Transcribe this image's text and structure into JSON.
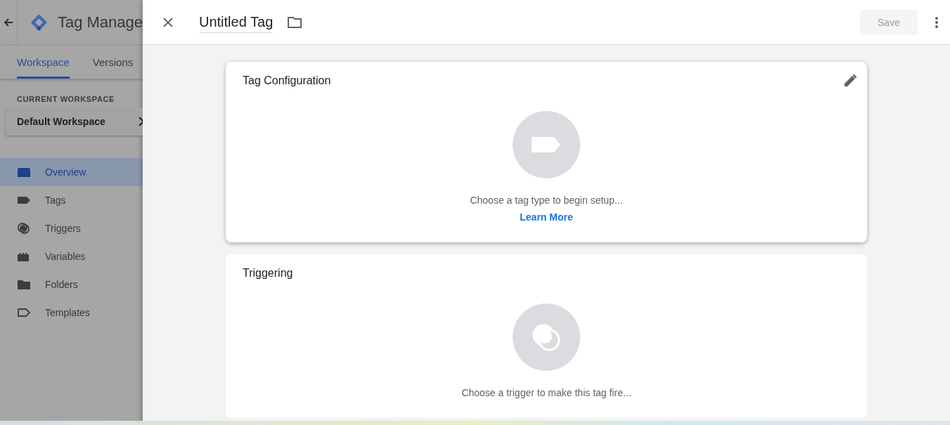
{
  "app": {
    "title": "Tag Manage"
  },
  "tabs": [
    {
      "label": "Workspace",
      "selected": true
    },
    {
      "label": "Versions",
      "selected": false
    }
  ],
  "workspace": {
    "heading": "CURRENT WORKSPACE",
    "name": "Default Workspace"
  },
  "nav": [
    {
      "label": "Overview",
      "kind": "overview",
      "selected": true
    },
    {
      "label": "Tags",
      "kind": "tag",
      "selected": false
    },
    {
      "label": "Triggers",
      "kind": "trigger",
      "selected": false
    },
    {
      "label": "Variables",
      "kind": "variable",
      "selected": false
    },
    {
      "label": "Folders",
      "kind": "folder",
      "selected": false
    },
    {
      "label": "Templates",
      "kind": "template",
      "selected": false
    }
  ],
  "panel": {
    "title": "Untitled Tag",
    "save": {
      "label": "Save",
      "disabled": true
    }
  },
  "cards": [
    {
      "title": "Tag Configuration",
      "kind": "tag",
      "editable": true,
      "message": "Choose a tag type to begin setup...",
      "link": "Learn More"
    },
    {
      "title": "Triggering",
      "kind": "trigger",
      "editable": false,
      "message": "Choose a trigger to make this tag fire..."
    }
  ]
}
